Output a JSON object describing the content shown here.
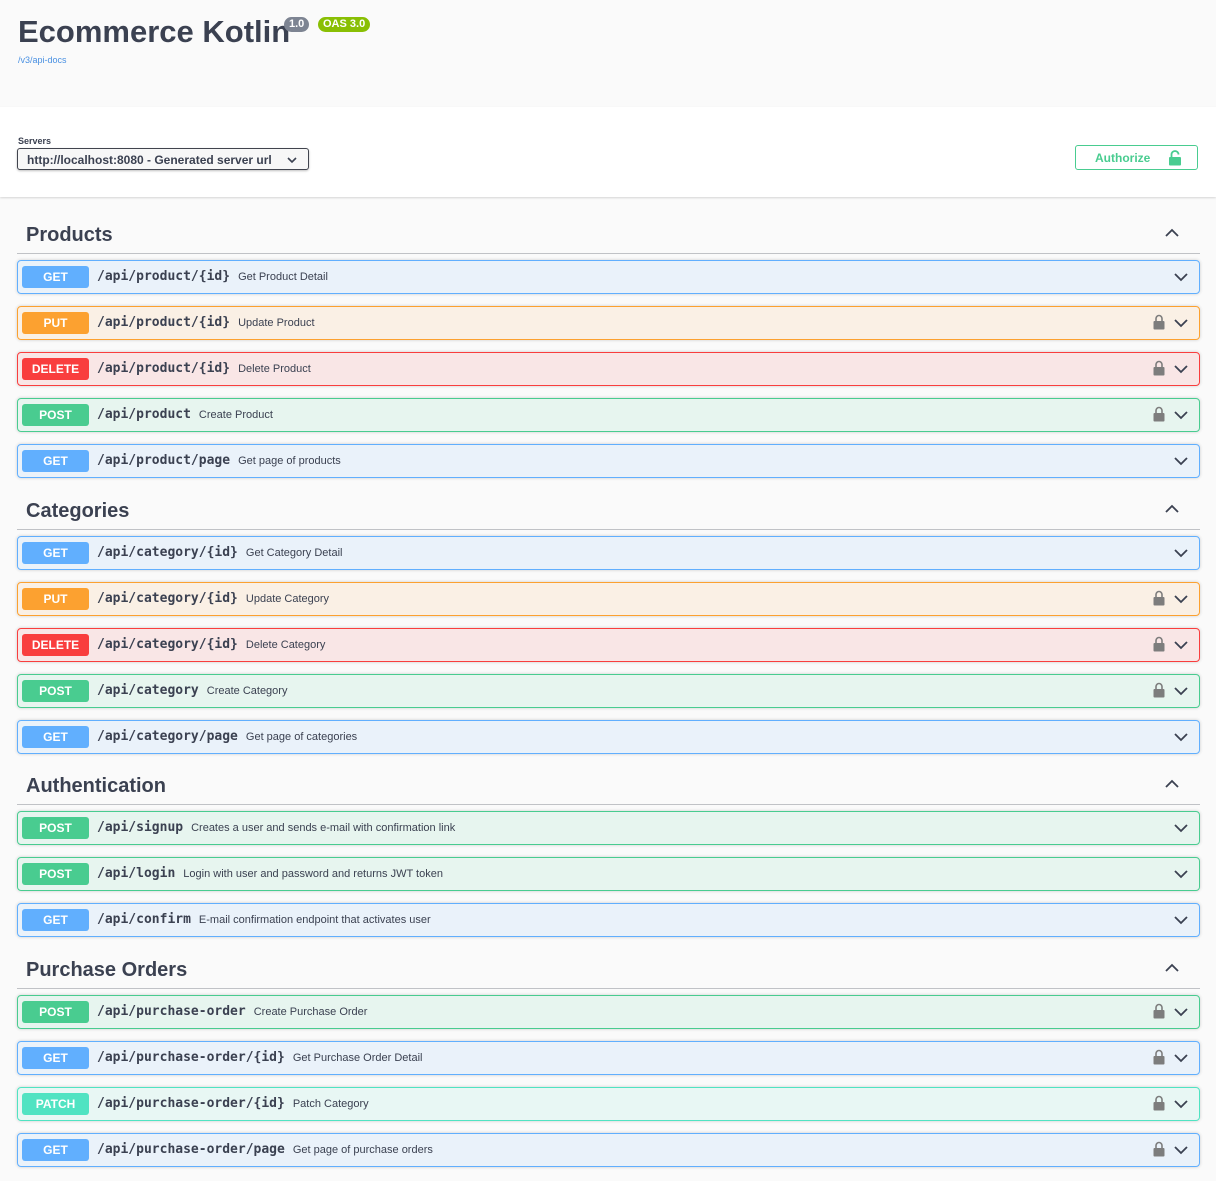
{
  "info": {
    "title": "Ecommerce Kotlin",
    "version": "1.0",
    "oas": "OAS 3.0",
    "api_docs_link": "/v3/api-docs"
  },
  "servers": {
    "label": "Servers",
    "selected": "http://localhost:8080 - Generated server url"
  },
  "authorize": {
    "label": "Authorize",
    "icon": "unlocked-padlock-icon"
  },
  "colors": {
    "get": "#61affe",
    "put": "#fca130",
    "delete": "#f93e3e",
    "post": "#49cc90",
    "patch": "#50e3c2"
  },
  "tags": [
    {
      "name": "Products",
      "ops": [
        {
          "method": "GET",
          "path": "/api/product/{id}",
          "summary": "Get Product Detail",
          "locked": false
        },
        {
          "method": "PUT",
          "path": "/api/product/{id}",
          "summary": "Update Product",
          "locked": true
        },
        {
          "method": "DELETE",
          "path": "/api/product/{id}",
          "summary": "Delete Product",
          "locked": true
        },
        {
          "method": "POST",
          "path": "/api/product",
          "summary": "Create Product",
          "locked": true
        },
        {
          "method": "GET",
          "path": "/api/product/page",
          "summary": "Get page of products",
          "locked": false
        }
      ]
    },
    {
      "name": "Categories",
      "ops": [
        {
          "method": "GET",
          "path": "/api/category/{id}",
          "summary": "Get Category Detail",
          "locked": false
        },
        {
          "method": "PUT",
          "path": "/api/category/{id}",
          "summary": "Update Category",
          "locked": true
        },
        {
          "method": "DELETE",
          "path": "/api/category/{id}",
          "summary": "Delete Category",
          "locked": true
        },
        {
          "method": "POST",
          "path": "/api/category",
          "summary": "Create Category",
          "locked": true
        },
        {
          "method": "GET",
          "path": "/api/category/page",
          "summary": "Get page of categories",
          "locked": false
        }
      ]
    },
    {
      "name": "Authentication",
      "ops": [
        {
          "method": "POST",
          "path": "/api/signup",
          "summary": "Creates a user and sends e-mail with confirmation link",
          "locked": false
        },
        {
          "method": "POST",
          "path": "/api/login",
          "summary": "Login with user and password and returns JWT token",
          "locked": false
        },
        {
          "method": "GET",
          "path": "/api/confirm",
          "summary": "E-mail confirmation endpoint that activates user",
          "locked": false
        }
      ]
    },
    {
      "name": "Purchase Orders",
      "ops": [
        {
          "method": "POST",
          "path": "/api/purchase-order",
          "summary": "Create Purchase Order",
          "locked": true
        },
        {
          "method": "GET",
          "path": "/api/purchase-order/{id}",
          "summary": "Get Purchase Order Detail",
          "locked": true
        },
        {
          "method": "PATCH",
          "path": "/api/purchase-order/{id}",
          "summary": "Patch Category",
          "locked": true
        },
        {
          "method": "GET",
          "path": "/api/purchase-order/page",
          "summary": "Get page of purchase orders",
          "locked": true
        }
      ]
    }
  ]
}
